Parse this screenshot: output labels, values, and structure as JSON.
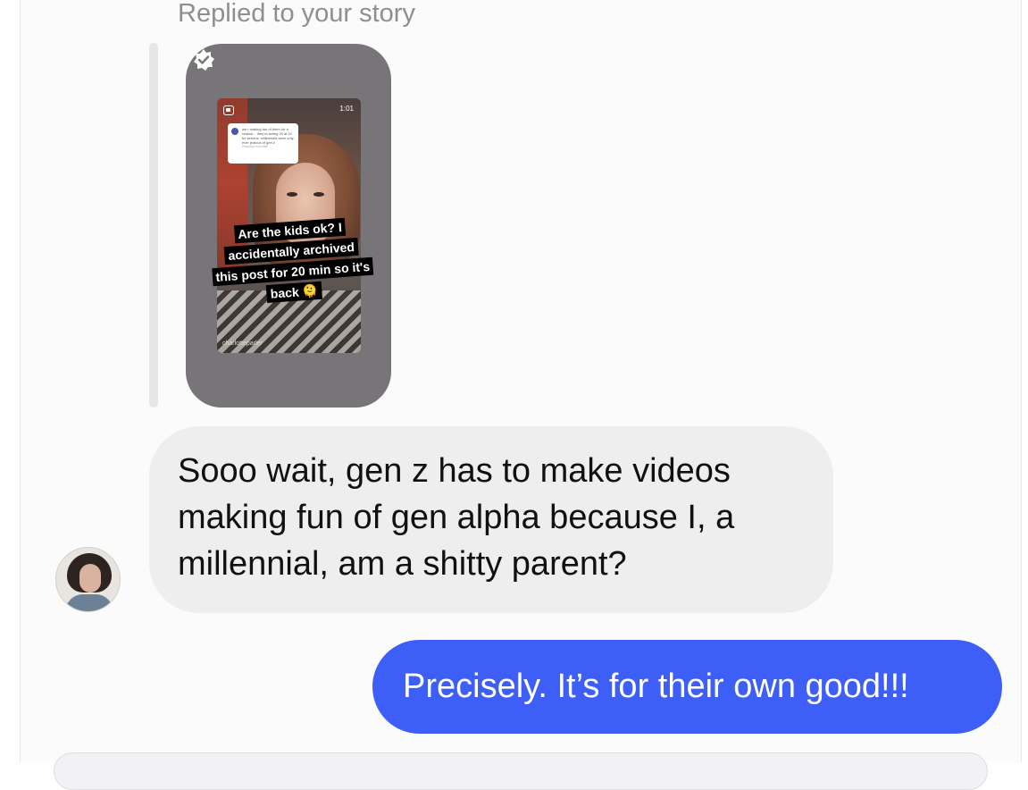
{
  "conversation": {
    "reply_context": "Replied to your story",
    "story": {
      "time": "1:01",
      "comment_text": "we r making fun of them for a reason... they're acting 20 at 10 be serious. millennials were only ever jealous of gen z",
      "comment_reply_label": "Replying to lucitski",
      "caption_lines": [
        "Are the kids ok? I",
        "accidentally archived",
        "this post for 20 min so it's",
        "back 🫠"
      ],
      "handle": "charlotteparler"
    },
    "incoming_message": "Sooo wait, gen z has to make videos making fun of gen alpha because I, a millennial, am a shitty parent?",
    "outgoing_message": "Precisely. It’s for their own good!!!"
  },
  "colors": {
    "outgoing_bubble": "#3d5ef7",
    "incoming_bubble": "#eeeeef",
    "secondary_text": "#8e8e93"
  },
  "icons": {
    "story_badge": "sparkle-check-icon",
    "story_type": "reel-icon"
  }
}
